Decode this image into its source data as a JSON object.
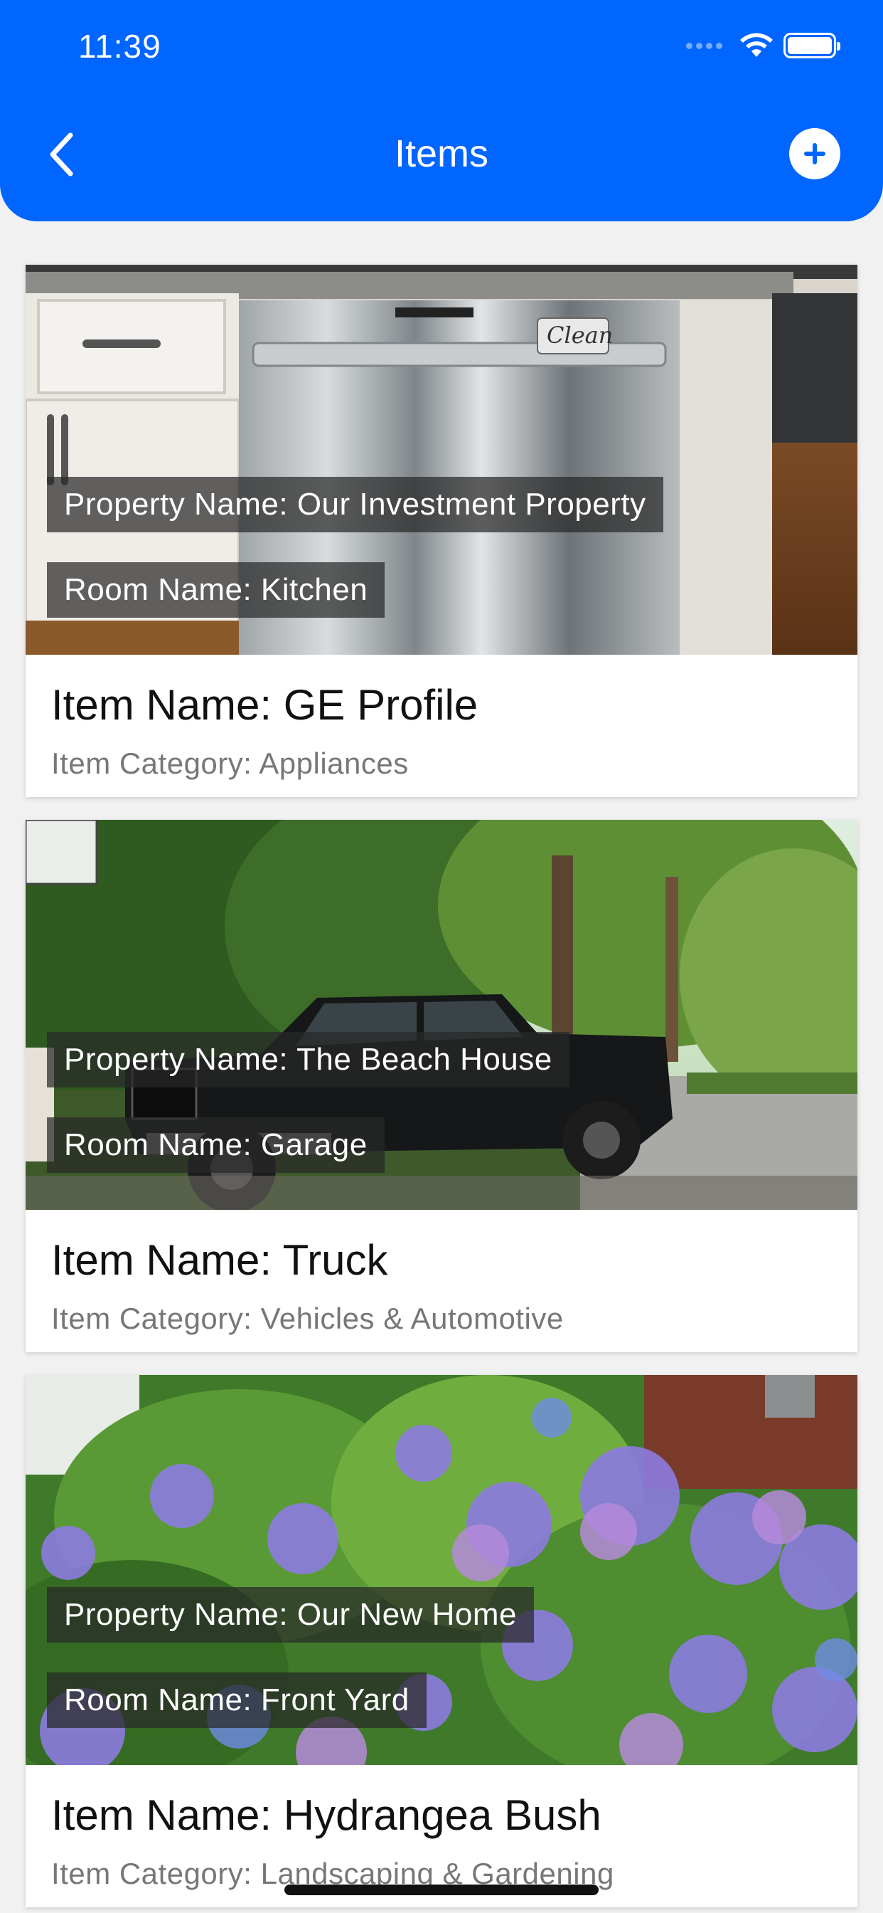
{
  "status_bar": {
    "time": "11:39"
  },
  "nav": {
    "title": "Items"
  },
  "items": [
    {
      "property": "Property Name: Our Investment Property",
      "room": "Room Name: Kitchen",
      "name": "Item Name: GE Profile",
      "category": "Item Category: Appliances",
      "image": "dishwasher-photo"
    },
    {
      "property": "Property Name: The Beach House",
      "room": "Room Name: Garage",
      "name": "Item Name: Truck",
      "category": "Item Category: Vehicles & Automotive",
      "image": "truck-photo"
    },
    {
      "property": "Property Name: Our New Home",
      "room": "Room Name: Front Yard",
      "name": "Item Name: Hydrangea Bush",
      "category": "Item Category: Landscaping & Gardening",
      "image": "hydrangea-photo"
    }
  ],
  "colors": {
    "accent": "#0066ff",
    "background": "#f1f1f1"
  },
  "image_watermark_text": "Clean"
}
